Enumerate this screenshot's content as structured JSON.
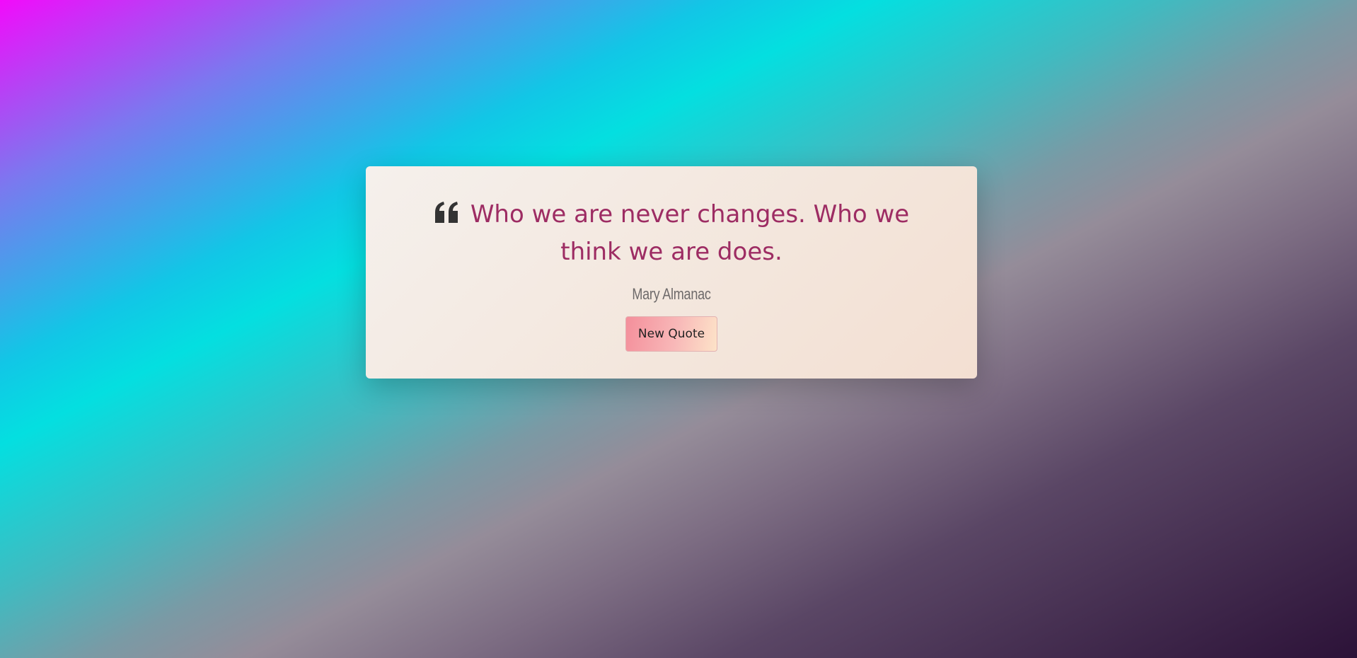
{
  "quote": {
    "text": "Who we are never changes. Who we think we are does.",
    "author": "Mary Almanac"
  },
  "controls": {
    "new_quote_label": "New Quote"
  },
  "icons": {
    "quote_mark": "quote-left-icon"
  },
  "colors": {
    "quote_text": "#9d2c63",
    "quote_text_secondary": "#c4294a",
    "author": "#6e6a6a",
    "button_start": "#f48f9b",
    "button_end": "#fde3c8"
  }
}
